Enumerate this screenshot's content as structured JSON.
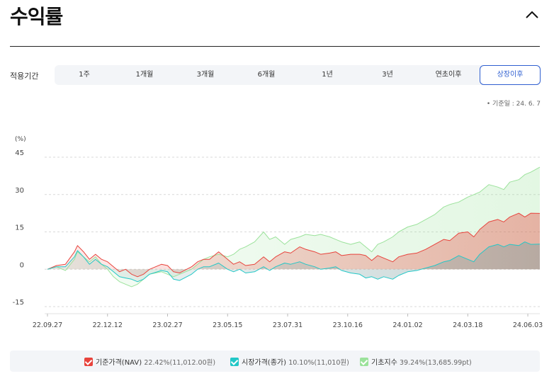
{
  "header": {
    "title": "수익률",
    "collapse_icon": "chevron-up-icon"
  },
  "period": {
    "label": "적용기간",
    "tabs": [
      "1주",
      "1개월",
      "3개월",
      "6개월",
      "1년",
      "3년",
      "연초이후",
      "상장이후"
    ],
    "selected": "상장이후"
  },
  "base_date": "기준일 : 24. 6. 7",
  "colors": {
    "nav": "#e8433c",
    "market": "#22c7c7",
    "index": "#9be29b",
    "accent": "#2f5fd0"
  },
  "chart_data": {
    "type": "area",
    "ylabel": "(%)",
    "ylim": [
      -15,
      45
    ],
    "yticks": [
      45,
      30,
      15,
      0,
      -15
    ],
    "xtick_labels": [
      "22.09.27",
      "22.12.12",
      "23.02.27",
      "23.05.15",
      "23.07.31",
      "23.10.16",
      "24.01.02",
      "24.03.18",
      "24.06.03"
    ],
    "x_range": [
      0,
      8.2
    ],
    "grid": true,
    "legend_position": "bottom",
    "series": [
      {
        "name": "기준가격(NAV)",
        "color": "#e8433c",
        "summary": "22.42%(11,012.00원)",
        "points": [
          [
            0,
            0
          ],
          [
            0.15,
            1.5
          ],
          [
            0.3,
            2
          ],
          [
            0.45,
            7
          ],
          [
            0.5,
            9.5
          ],
          [
            0.6,
            7
          ],
          [
            0.7,
            4
          ],
          [
            0.8,
            6
          ],
          [
            0.9,
            4
          ],
          [
            1.0,
            3
          ],
          [
            1.1,
            1
          ],
          [
            1.2,
            -1
          ],
          [
            1.3,
            0
          ],
          [
            1.4,
            -2
          ],
          [
            1.5,
            -3
          ],
          [
            1.6,
            -2
          ],
          [
            1.7,
            0
          ],
          [
            1.9,
            2
          ],
          [
            2.0,
            1.5
          ],
          [
            2.1,
            -1
          ],
          [
            2.2,
            -1.5
          ],
          [
            2.4,
            1
          ],
          [
            2.5,
            3
          ],
          [
            2.6,
            4
          ],
          [
            2.7,
            4
          ],
          [
            2.85,
            7
          ],
          [
            3.0,
            4
          ],
          [
            3.1,
            2
          ],
          [
            3.2,
            3
          ],
          [
            3.3,
            1.5
          ],
          [
            3.45,
            2
          ],
          [
            3.6,
            5
          ],
          [
            3.7,
            3
          ],
          [
            3.8,
            5
          ],
          [
            3.95,
            7
          ],
          [
            4.05,
            6.5
          ],
          [
            4.2,
            9
          ],
          [
            4.3,
            8
          ],
          [
            4.45,
            7
          ],
          [
            4.55,
            6
          ],
          [
            4.7,
            6.5
          ],
          [
            4.8,
            7
          ],
          [
            4.9,
            5.5
          ],
          [
            5.05,
            6
          ],
          [
            5.2,
            6
          ],
          [
            5.3,
            5.5
          ],
          [
            5.4,
            3.5
          ],
          [
            5.5,
            5.5
          ],
          [
            5.6,
            4.5
          ],
          [
            5.75,
            3
          ],
          [
            5.85,
            5
          ],
          [
            6.0,
            6
          ],
          [
            6.15,
            6.5
          ],
          [
            6.3,
            8
          ],
          [
            6.45,
            10
          ],
          [
            6.6,
            12
          ],
          [
            6.7,
            11.5
          ],
          [
            6.85,
            14.5
          ],
          [
            7.0,
            15
          ],
          [
            7.1,
            13
          ],
          [
            7.2,
            16
          ],
          [
            7.35,
            19
          ],
          [
            7.5,
            20
          ],
          [
            7.6,
            19
          ],
          [
            7.7,
            21
          ],
          [
            7.85,
            22.5
          ],
          [
            7.95,
            21
          ],
          [
            8.05,
            22.5
          ],
          [
            8.2,
            22.42
          ]
        ]
      },
      {
        "name": "시장가격(종가)",
        "color": "#22c7c7",
        "summary": "10.10%(11,010원)",
        "points": [
          [
            0,
            0
          ],
          [
            0.15,
            1
          ],
          [
            0.3,
            1
          ],
          [
            0.45,
            5
          ],
          [
            0.5,
            7.5
          ],
          [
            0.6,
            5
          ],
          [
            0.7,
            2
          ],
          [
            0.8,
            4
          ],
          [
            0.9,
            2
          ],
          [
            1.0,
            1
          ],
          [
            1.1,
            -1
          ],
          [
            1.2,
            -3
          ],
          [
            1.3,
            -3.5
          ],
          [
            1.4,
            -4
          ],
          [
            1.5,
            -5
          ],
          [
            1.6,
            -4
          ],
          [
            1.7,
            -2
          ],
          [
            1.9,
            -0.5
          ],
          [
            2.0,
            -1
          ],
          [
            2.1,
            -4
          ],
          [
            2.2,
            -4.5
          ],
          [
            2.4,
            -2
          ],
          [
            2.5,
            0
          ],
          [
            2.6,
            1
          ],
          [
            2.7,
            1
          ],
          [
            2.85,
            2.5
          ],
          [
            3.0,
            0
          ],
          [
            3.1,
            -1
          ],
          [
            3.2,
            0
          ],
          [
            3.3,
            -1.5
          ],
          [
            3.45,
            -1
          ],
          [
            3.6,
            1
          ],
          [
            3.7,
            -0.5
          ],
          [
            3.8,
            1
          ],
          [
            3.95,
            2.5
          ],
          [
            4.05,
            2
          ],
          [
            4.2,
            3
          ],
          [
            4.3,
            2
          ],
          [
            4.45,
            1
          ],
          [
            4.55,
            0
          ],
          [
            4.7,
            0.5
          ],
          [
            4.8,
            1
          ],
          [
            4.9,
            -0.5
          ],
          [
            5.05,
            -1.5
          ],
          [
            5.2,
            -2
          ],
          [
            5.3,
            -3.5
          ],
          [
            5.4,
            -3
          ],
          [
            5.5,
            -4
          ],
          [
            5.6,
            -3
          ],
          [
            5.75,
            -4
          ],
          [
            5.85,
            -2.5
          ],
          [
            6.0,
            -1
          ],
          [
            6.15,
            -0.5
          ],
          [
            6.3,
            0.5
          ],
          [
            6.45,
            1.5
          ],
          [
            6.6,
            3
          ],
          [
            6.7,
            3.5
          ],
          [
            6.85,
            5.5
          ],
          [
            7.0,
            4
          ],
          [
            7.1,
            3
          ],
          [
            7.2,
            6
          ],
          [
            7.35,
            9
          ],
          [
            7.5,
            10
          ],
          [
            7.6,
            9
          ],
          [
            7.7,
            10
          ],
          [
            7.85,
            9.5
          ],
          [
            7.95,
            11
          ],
          [
            8.05,
            10
          ],
          [
            8.2,
            10.1
          ]
        ]
      },
      {
        "name": "기초지수",
        "color": "#9be29b",
        "summary": "39.24%(13,685.99pt)",
        "points": [
          [
            0,
            0
          ],
          [
            0.15,
            1
          ],
          [
            0.3,
            -0.5
          ],
          [
            0.45,
            4
          ],
          [
            0.5,
            7
          ],
          [
            0.6,
            5
          ],
          [
            0.7,
            3
          ],
          [
            0.8,
            5
          ],
          [
            0.9,
            2
          ],
          [
            1.0,
            0
          ],
          [
            1.1,
            -3
          ],
          [
            1.2,
            -5
          ],
          [
            1.3,
            -6
          ],
          [
            1.4,
            -7
          ],
          [
            1.5,
            -6
          ],
          [
            1.6,
            -4
          ],
          [
            1.7,
            -2
          ],
          [
            1.9,
            -1
          ],
          [
            2.0,
            -2
          ],
          [
            2.1,
            -3
          ],
          [
            2.2,
            -2
          ],
          [
            2.4,
            0
          ],
          [
            2.5,
            2
          ],
          [
            2.6,
            4
          ],
          [
            2.7,
            5
          ],
          [
            2.85,
            6
          ],
          [
            3.0,
            5
          ],
          [
            3.1,
            6
          ],
          [
            3.2,
            8
          ],
          [
            3.3,
            9
          ],
          [
            3.45,
            11
          ],
          [
            3.6,
            15
          ],
          [
            3.7,
            12
          ],
          [
            3.8,
            13
          ],
          [
            3.95,
            10
          ],
          [
            4.05,
            12
          ],
          [
            4.2,
            13
          ],
          [
            4.3,
            14
          ],
          [
            4.45,
            13.5
          ],
          [
            4.55,
            14
          ],
          [
            4.7,
            13
          ],
          [
            4.8,
            12
          ],
          [
            4.9,
            11
          ],
          [
            5.05,
            10
          ],
          [
            5.2,
            11
          ],
          [
            5.3,
            9
          ],
          [
            5.4,
            7
          ],
          [
            5.5,
            10
          ],
          [
            5.6,
            11
          ],
          [
            5.75,
            13
          ],
          [
            5.85,
            15
          ],
          [
            6.0,
            17
          ],
          [
            6.15,
            18
          ],
          [
            6.3,
            20
          ],
          [
            6.45,
            22
          ],
          [
            6.6,
            25
          ],
          [
            6.7,
            26
          ],
          [
            6.85,
            27
          ],
          [
            7.0,
            29
          ],
          [
            7.1,
            30
          ],
          [
            7.2,
            31
          ],
          [
            7.35,
            34
          ],
          [
            7.5,
            33
          ],
          [
            7.6,
            32
          ],
          [
            7.7,
            35
          ],
          [
            7.85,
            36
          ],
          [
            7.95,
            38
          ],
          [
            8.05,
            39
          ],
          [
            8.2,
            41
          ]
        ]
      }
    ]
  }
}
